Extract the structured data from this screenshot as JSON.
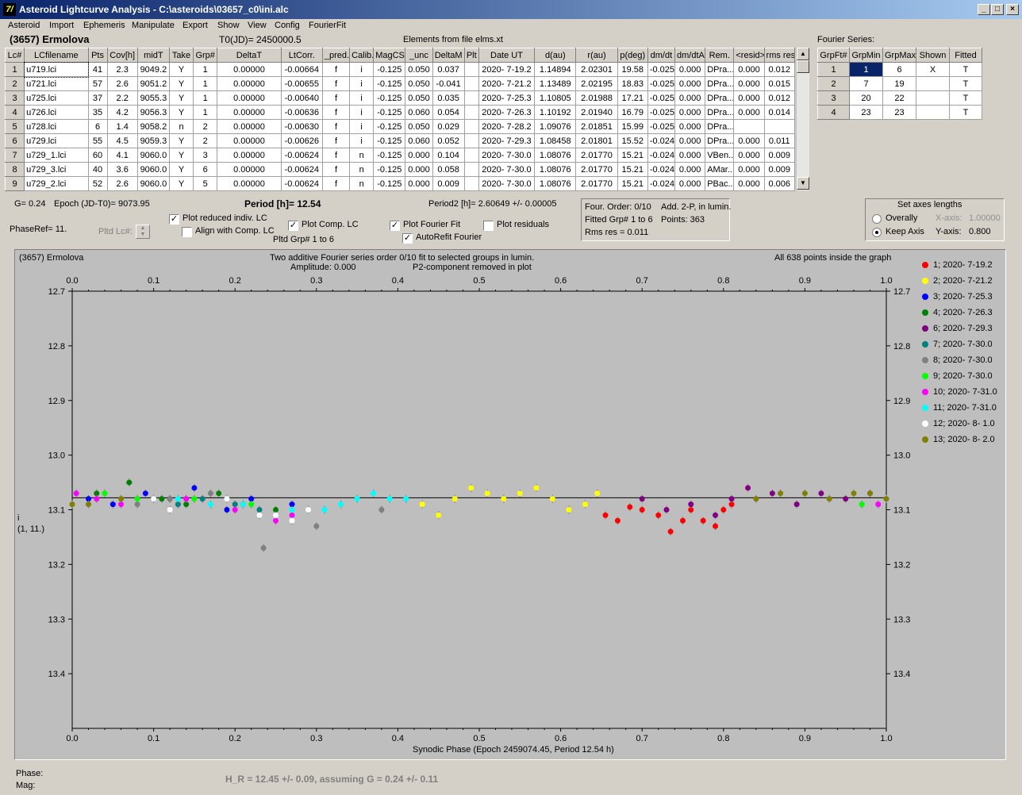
{
  "window": {
    "title": "Asteroid Lightcurve Analysis - C:\\asteroids\\03657_c0\\ini.alc",
    "icon_text": "7/",
    "min": "_",
    "max": "□",
    "close": "×"
  },
  "menu": [
    "Asteroid",
    "Import",
    "Ephemeris",
    "Manipulate",
    "Export",
    "Show",
    "View",
    "Config",
    "FourierFit"
  ],
  "header": {
    "asteroid": "(3657) Ermolova",
    "t0": "T0(JD)= 2450000.5",
    "elements": "Elements from file elms.xt",
    "fourier_series": "Fourier Series:"
  },
  "lc_table": {
    "columns": [
      "Lc#",
      "LCfilename",
      "Pts",
      "Cov[h]",
      "midT",
      "Take",
      "Grp#",
      "DeltaT",
      "LtCorr.",
      "_pred.",
      "Calib.",
      "MagCS",
      "_unc",
      "DeltaM",
      "Plt",
      "Date UT",
      "d(au)",
      "r(au)",
      "p(deg)",
      "dm/dt",
      "dm/dtA",
      "Rem.",
      "<resid>",
      "rms res"
    ],
    "rows": [
      [
        "1",
        "u719.lci",
        "41",
        "2.3",
        "9049.2",
        "Y",
        "1",
        "0.00000",
        "-0.00664",
        "f",
        "i",
        "-0.125",
        "0.050",
        "0.037",
        "",
        "2020- 7-19.2",
        "1.14894",
        "2.02301",
        "19.58",
        "-0.025",
        "0.000",
        "DPra...",
        "0.000",
        "0.012"
      ],
      [
        "2",
        "u721.lci",
        "57",
        "2.6",
        "9051.2",
        "Y",
        "1",
        "0.00000",
        "-0.00655",
        "f",
        "i",
        "-0.125",
        "0.050",
        "-0.041",
        "",
        "2020- 7-21.2",
        "1.13489",
        "2.02195",
        "18.83",
        "-0.025",
        "0.000",
        "DPra...",
        "0.000",
        "0.015"
      ],
      [
        "3",
        "u725.lci",
        "37",
        "2.2",
        "9055.3",
        "Y",
        "1",
        "0.00000",
        "-0.00640",
        "f",
        "i",
        "-0.125",
        "0.050",
        "0.035",
        "",
        "2020- 7-25.3",
        "1.10805",
        "2.01988",
        "17.21",
        "-0.025",
        "0.000",
        "DPra...",
        "0.000",
        "0.012"
      ],
      [
        "4",
        "u726.lci",
        "35",
        "4.2",
        "9056.3",
        "Y",
        "1",
        "0.00000",
        "-0.00636",
        "f",
        "i",
        "-0.125",
        "0.060",
        "0.054",
        "",
        "2020- 7-26.3",
        "1.10192",
        "2.01940",
        "16.79",
        "-0.025",
        "0.000",
        "DPra...",
        "0.000",
        "0.014"
      ],
      [
        "5",
        "u728.lci",
        "6",
        "1.4",
        "9058.2",
        "n",
        "2",
        "0.00000",
        "-0.00630",
        "f",
        "i",
        "-0.125",
        "0.050",
        "0.029",
        "",
        "2020- 7-28.2",
        "1.09076",
        "2.01851",
        "15.99",
        "-0.025",
        "0.000",
        "DPra...",
        "",
        ""
      ],
      [
        "6",
        "u729.lci",
        "55",
        "4.5",
        "9059.3",
        "Y",
        "2",
        "0.00000",
        "-0.00626",
        "f",
        "i",
        "-0.125",
        "0.060",
        "0.052",
        "",
        "2020- 7-29.3",
        "1.08458",
        "2.01801",
        "15.52",
        "-0.024",
        "0.000",
        "DPra...",
        "0.000",
        "0.011"
      ],
      [
        "7",
        "u729_1.lci",
        "60",
        "4.1",
        "9060.0",
        "Y",
        "3",
        "0.00000",
        "-0.00624",
        "f",
        "n",
        "-0.125",
        "0.000",
        "0.104",
        "",
        "2020- 7-30.0",
        "1.08076",
        "2.01770",
        "15.21",
        "-0.024",
        "0.000",
        "VBen...",
        "0.000",
        "0.009"
      ],
      [
        "8",
        "u729_3.lci",
        "40",
        "3.6",
        "9060.0",
        "Y",
        "6",
        "0.00000",
        "-0.00624",
        "f",
        "n",
        "-0.125",
        "0.000",
        "0.058",
        "",
        "2020- 7-30.0",
        "1.08076",
        "2.01770",
        "15.21",
        "-0.024",
        "0.000",
        "AMar...",
        "0.000",
        "0.009"
      ],
      [
        "9",
        "u729_2.lci",
        "52",
        "2.6",
        "9060.0",
        "Y",
        "5",
        "0.00000",
        "-0.00624",
        "f",
        "n",
        "-0.125",
        "0.000",
        "0.009",
        "",
        "2020- 7-30.0",
        "1.08076",
        "2.01770",
        "15.21",
        "-0.024",
        "0.000",
        "PBac...",
        "0.000",
        "0.006"
      ]
    ]
  },
  "fourier_table": {
    "columns": [
      "GrpFt#",
      "GrpMin",
      "GrpMax",
      "Shown",
      "Fitted"
    ],
    "rows": [
      [
        "1",
        "1",
        "6",
        "X",
        "T"
      ],
      [
        "2",
        "7",
        "19",
        "",
        "T"
      ],
      [
        "3",
        "20",
        "22",
        "",
        "T"
      ],
      [
        "4",
        "23",
        "23",
        "",
        "T"
      ]
    ]
  },
  "controls": {
    "g_value": "G= 0.24",
    "epoch": "Epoch (JD-T0)= 9073.95",
    "period": "Period [h]= 12.54",
    "period2": "Period2 [h]= 2.60649 +/- 0.00005",
    "phase_ref": "PhaseRef= 11.",
    "pltd_lc": "Pltd Lc#:",
    "plot_reduced": "Plot reduced indiv. LC",
    "align_comp": "Align with Comp. LC",
    "plot_comp": "Plot Comp. LC",
    "pltd_grp": "Pltd Grp#  1   to   6",
    "plot_fourier": "Plot Fourier Fit",
    "autorefit": "AutoRefit Fourier",
    "plot_residuals": "Plot residuals",
    "four_order": "Four. Order:  0/10",
    "add2p": "Add. 2-P, in lumin.",
    "fitted_grp": "Fitted Grp# 1 to 6",
    "points": "Points: 363",
    "rms_res": "Rms res     = 0.011",
    "set_axes": "Set axes lengths",
    "overally": "Overally",
    "keep_axis": "Keep Axis",
    "x_axis_label": "X-axis:",
    "x_axis_val": "1.00000",
    "y_axis_label": "Y-axis:",
    "y_axis_val": "0.800"
  },
  "plot": {
    "name": "(3657) Ermolova",
    "line1": "Two additive Fourier series order 0/10 fit to selected groups in lumin.",
    "amplitude": "Amplitude: 0.000",
    "p2": "P2-component removed in plot",
    "inside": "All 638 points inside the graph",
    "xlabel": "Synodic Phase (Epoch 2459074.45, Period 12.54 h)",
    "ylabel1": "i",
    "ylabel2": "(1, 11.)",
    "x_ticks": [
      "0.0",
      "0.1",
      "0.2",
      "0.3",
      "0.4",
      "0.5",
      "0.6",
      "0.7",
      "0.8",
      "0.9",
      "1.0"
    ],
    "y_ticks": [
      "12.7",
      "12.8",
      "12.9",
      "13.0",
      "13.1",
      "13.2",
      "13.3",
      "13.4"
    ]
  },
  "chart_data": {
    "type": "scatter",
    "xlim": [
      0.0,
      1.0
    ],
    "ylim": [
      12.7,
      13.5
    ],
    "y_inverted": true,
    "fit_line_y": 13.078,
    "series": [
      {
        "name": "1; 2020- 7-19.2",
        "color": "#ff0000",
        "x": [
          0.655,
          0.67,
          0.685,
          0.7,
          0.72,
          0.735,
          0.75,
          0.76,
          0.775,
          0.79,
          0.8,
          0.81
        ],
        "y": [
          13.11,
          13.12,
          13.095,
          13.1,
          13.11,
          13.14,
          13.12,
          13.1,
          13.12,
          13.13,
          13.1,
          13.09
        ]
      },
      {
        "name": "2; 2020- 7-21.2",
        "color": "#ffff00",
        "x": [
          0.43,
          0.45,
          0.47,
          0.49,
          0.51,
          0.53,
          0.55,
          0.57,
          0.59,
          0.61,
          0.63,
          0.645
        ],
        "y": [
          13.09,
          13.11,
          13.08,
          13.06,
          13.07,
          13.08,
          13.07,
          13.06,
          13.08,
          13.1,
          13.09,
          13.07
        ]
      },
      {
        "name": "3; 2020- 7-25.3",
        "color": "#0000ff",
        "x": [
          0.02,
          0.05,
          0.09,
          0.12,
          0.15,
          0.19,
          0.22,
          0.27
        ],
        "y": [
          13.08,
          13.09,
          13.07,
          13.08,
          13.06,
          13.1,
          13.08,
          13.09
        ]
      },
      {
        "name": "4; 2020- 7-26.3",
        "color": "#008000",
        "x": [
          0.03,
          0.07,
          0.11,
          0.14,
          0.18,
          0.21,
          0.25
        ],
        "y": [
          13.07,
          13.05,
          13.08,
          13.09,
          13.07,
          13.09,
          13.1
        ]
      },
      {
        "name": "6; 2020- 7-29.3",
        "color": "#800080",
        "x": [
          0.7,
          0.73,
          0.76,
          0.79,
          0.81,
          0.83,
          0.86,
          0.89,
          0.92,
          0.95,
          0.98
        ],
        "y": [
          13.08,
          13.1,
          13.09,
          13.11,
          13.08,
          13.06,
          13.07,
          13.09,
          13.07,
          13.08,
          13.07
        ]
      },
      {
        "name": "7; 2020- 7-30.0",
        "color": "#008080",
        "x": [
          0.1,
          0.13,
          0.16,
          0.2,
          0.23
        ],
        "y": [
          13.08,
          13.09,
          13.08,
          13.09,
          13.1
        ]
      },
      {
        "name": "8; 2020- 7-30.0",
        "color": "#808080",
        "x": [
          0.08,
          0.12,
          0.17,
          0.235,
          0.3,
          0.38
        ],
        "y": [
          13.09,
          13.08,
          13.07,
          13.17,
          13.13,
          13.1
        ]
      },
      {
        "name": "9; 2020- 7-30.0",
        "color": "#00ff00",
        "x": [
          0.04,
          0.08,
          0.15,
          0.22,
          0.97
        ],
        "y": [
          13.07,
          13.08,
          13.08,
          13.09,
          13.09
        ]
      },
      {
        "name": "10; 2020- 7-31.0",
        "color": "#ff00ff",
        "x": [
          0.005,
          0.03,
          0.06,
          0.14,
          0.2,
          0.25,
          0.27,
          0.99
        ],
        "y": [
          13.07,
          13.08,
          13.09,
          13.08,
          13.1,
          13.12,
          13.11,
          13.09
        ]
      },
      {
        "name": "11; 2020- 7-31.0",
        "color": "#00ffff",
        "x": [
          0.13,
          0.17,
          0.21,
          0.27,
          0.31,
          0.33,
          0.35,
          0.37,
          0.39,
          0.41
        ],
        "y": [
          13.08,
          13.09,
          13.09,
          13.1,
          13.1,
          13.09,
          13.08,
          13.07,
          13.08,
          13.08
        ]
      },
      {
        "name": "12; 2020- 8- 1.0",
        "color": "#ffffff",
        "x": [
          0.1,
          0.12,
          0.19,
          0.23,
          0.25,
          0.27,
          0.29
        ],
        "y": [
          13.08,
          13.1,
          13.08,
          13.11,
          13.11,
          13.12,
          13.1
        ]
      },
      {
        "name": "13; 2020- 8- 2.0",
        "color": "#808000",
        "x": [
          0.0,
          0.02,
          0.06,
          0.84,
          0.87,
          0.9,
          0.93,
          0.96,
          0.98,
          1.0
        ],
        "y": [
          13.09,
          13.09,
          13.08,
          13.08,
          13.07,
          13.07,
          13.08,
          13.07,
          13.07,
          13.08
        ]
      }
    ]
  },
  "status": {
    "phase": "Phase:",
    "mag": "Mag:",
    "hr": "H_R = 12.45 +/- 0.09, assuming G = 0.24 +/- 0.11"
  }
}
